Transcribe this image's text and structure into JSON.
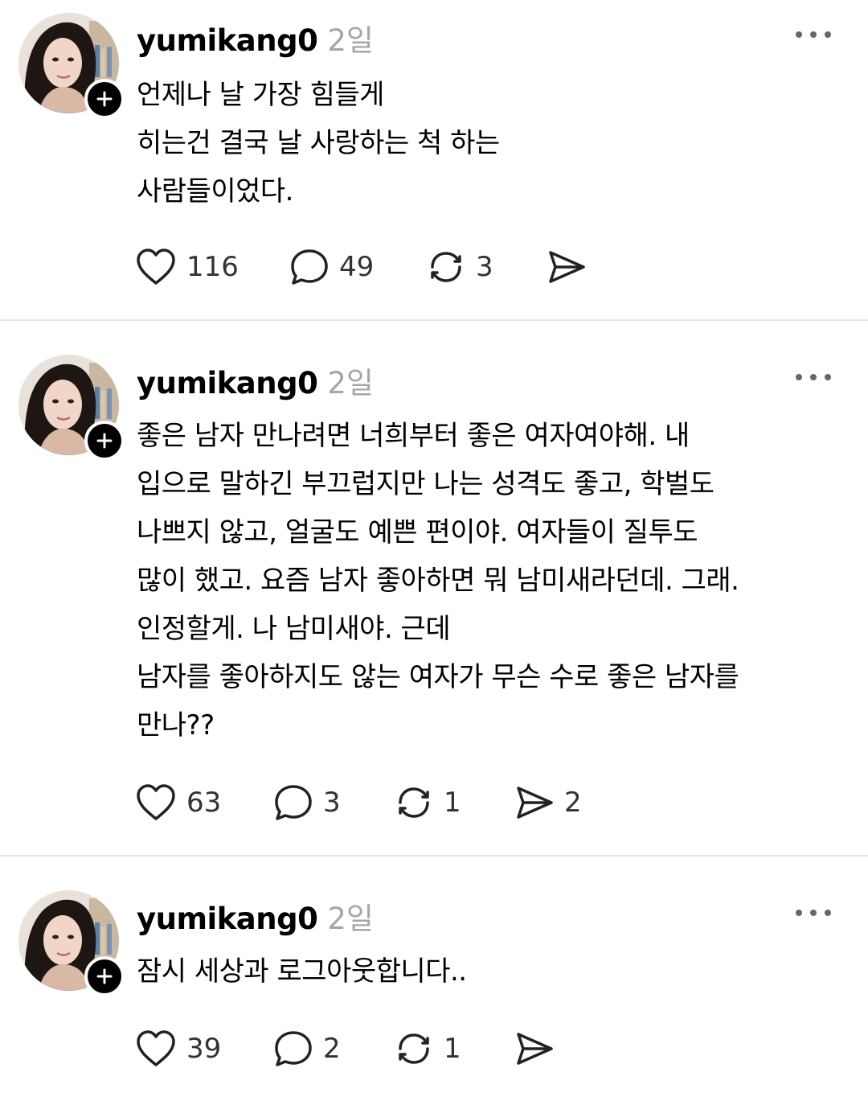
{
  "posts": [
    {
      "username": "yumikang0",
      "time": "2일",
      "text": "언제나 날 가장 힘들게\n히는건 결국 날 사랑하는 척 하는\n사람들이었다.",
      "likes": "116",
      "comments": "49",
      "reposts": "3",
      "shares": ""
    },
    {
      "username": "yumikang0",
      "time": "2일",
      "text": "좋은 남자 만나려면 너희부터 좋은 여자여야해. 내\n입으로 말하긴 부끄럽지만 나는 성격도 좋고, 학벌도\n나쁘지 않고, 얼굴도 예쁜 편이야. 여자들이 질투도\n많이 했고. 요즘 남자 좋아하면 뭐 남미새라던데. 그래.\n인정할게. 나 남미새야. 근데\n남자를 좋아하지도 않는 여자가 무슨 수로 좋은 남자를\n만나??",
      "likes": "63",
      "comments": "3",
      "reposts": "1",
      "shares": "2"
    },
    {
      "username": "yumikang0",
      "time": "2일",
      "text": "잠시 세상과 로그아웃합니다..",
      "likes": "39",
      "comments": "2",
      "reposts": "1",
      "shares": ""
    }
  ]
}
